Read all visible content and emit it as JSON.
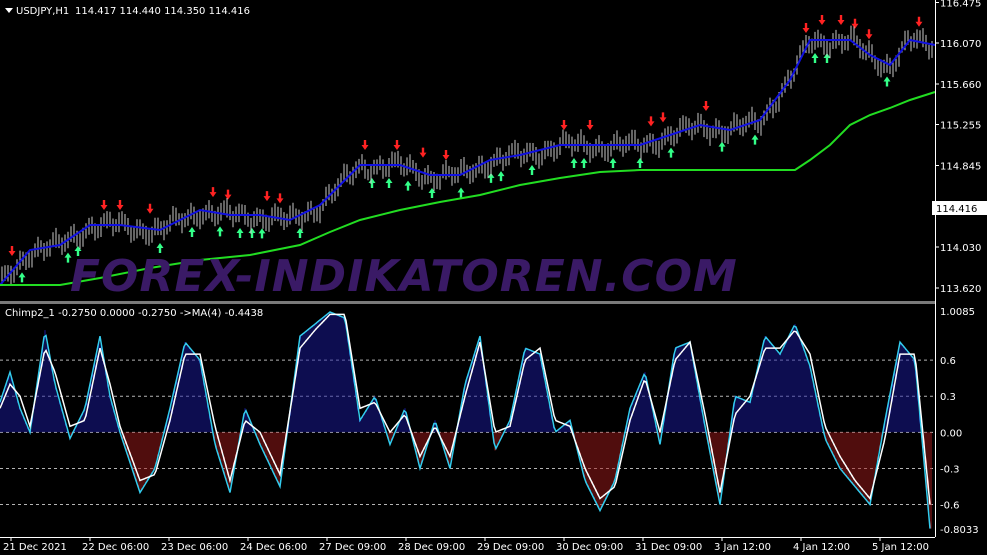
{
  "header": {
    "symbol": "USDJPY,H1",
    "ohlc": "114.417 114.440 114.350 114.416"
  },
  "indicator_header": "Chimp2_1 -0.2750 0.0000 -0.2750  ->MA(4) -0.4438",
  "watermark": "FOREX-INDIKATOREN.COM",
  "colors": {
    "background": "#000000",
    "upper_band": "#1010e0",
    "ma_green": "#22dd22",
    "arrow_up": "#33ff88",
    "arrow_down": "#ff2222",
    "hist_pos": "#1a1aa0",
    "hist_neg": "#a01a1a",
    "osc_cyan": "#33ccee",
    "osc_white": "#ffffff",
    "grid": "#b4b4b4"
  },
  "price_axis": {
    "labels": [
      "116.475",
      "116.070",
      "115.660",
      "115.255",
      "114.845",
      "114.416",
      "114.030",
      "113.620"
    ],
    "current_price": "114.416"
  },
  "indicator_axis": {
    "labels": [
      "1.0085",
      "0.6",
      "0.3",
      "0.00",
      "-0.3",
      "-0.6",
      "-0.8033"
    ]
  },
  "time_axis": {
    "labels": [
      "21 Dec 2021",
      "22 Dec 06:00",
      "23 Dec 06:00",
      "24 Dec 06:00",
      "27 Dec 09:00",
      "28 Dec 09:00",
      "29 Dec 09:00",
      "30 Dec 09:00",
      "31 Dec 09:00",
      "3 Jan 12:00",
      "4 Jan 12:00",
      "5 Jan 12:00"
    ]
  },
  "chart_data": [
    {
      "type": "line",
      "title": "USDJPY,H1",
      "ylim": [
        113.5,
        116.5
      ],
      "series": [
        {
          "name": "",
          "x": [
            0,
            30,
            60,
            90,
            120,
            160,
            200,
            230,
            260,
            290,
            320,
            340,
            360,
            380,
            400,
            430,
            460,
            490,
            520,
            560,
            600,
            640,
            670,
            700,
            730,
            760,
            790,
            810,
            830,
            850,
            870,
            890,
            910,
            935
          ],
          "values": [
            113.65,
            114.0,
            114.05,
            114.25,
            114.25,
            114.2,
            114.4,
            114.35,
            114.35,
            114.3,
            114.45,
            114.65,
            114.85,
            114.85,
            114.85,
            114.75,
            114.75,
            114.9,
            114.95,
            115.05,
            115.05,
            115.05,
            115.15,
            115.25,
            115.2,
            115.3,
            115.7,
            116.1,
            116.1,
            116.1,
            115.95,
            115.85,
            116.1,
            116.05
          ]
        },
        {
          "name": "",
          "x": [
            0,
            60,
            100,
            150,
            200,
            250,
            300,
            330,
            360,
            400,
            440,
            480,
            520,
            560,
            600,
            640,
            680,
            720,
            760,
            795,
            810,
            830,
            850,
            870,
            890,
            910,
            935
          ],
          "values": [
            113.65,
            113.65,
            113.72,
            113.82,
            113.9,
            113.95,
            114.05,
            114.18,
            114.3,
            114.4,
            114.48,
            114.55,
            114.65,
            114.72,
            114.78,
            114.8,
            114.8,
            114.8,
            114.8,
            114.8,
            114.9,
            115.05,
            115.25,
            115.35,
            115.42,
            115.5,
            115.58
          ]
        }
      ]
    },
    {
      "type": "line",
      "title": "Chimp2_1",
      "ylim": [
        -0.8033,
        1.0085
      ],
      "series": [
        {
          "name": "",
          "x": [
            0,
            10,
            20,
            30,
            45,
            55,
            70,
            85,
            100,
            110,
            120,
            140,
            155,
            170,
            185,
            200,
            215,
            230,
            245,
            260,
            280,
            300,
            315,
            330,
            345,
            360,
            375,
            390,
            405,
            420,
            435,
            450,
            465,
            480,
            495,
            510,
            525,
            540,
            555,
            570,
            585,
            600,
            615,
            630,
            645,
            660,
            675,
            690,
            705,
            720,
            735,
            750,
            765,
            780,
            795,
            810,
            825,
            840,
            855,
            870,
            885,
            900,
            915,
            930
          ],
          "values": [
            0.25,
            0.5,
            0.2,
            0.0,
            0.85,
            0.4,
            -0.05,
            0.2,
            0.8,
            0.3,
            0.0,
            -0.5,
            -0.3,
            0.2,
            0.75,
            0.6,
            -0.1,
            -0.5,
            0.2,
            -0.1,
            -0.45,
            0.8,
            0.9,
            1.0,
            0.95,
            0.1,
            0.3,
            -0.1,
            0.2,
            -0.3,
            0.1,
            -0.3,
            0.4,
            0.8,
            -0.15,
            0.1,
            0.7,
            0.65,
            0.0,
            0.1,
            -0.4,
            -0.65,
            -0.4,
            0.2,
            0.5,
            -0.1,
            0.7,
            0.75,
            0.05,
            -0.6,
            0.3,
            0.25,
            0.8,
            0.65,
            0.9,
            0.55,
            -0.05,
            -0.3,
            -0.45,
            -0.6,
            0.1,
            0.75,
            0.6,
            -0.8
          ]
        },
        {
          "name": "",
          "x": [
            0,
            10,
            20,
            30,
            45,
            55,
            70,
            85,
            100,
            110,
            120,
            140,
            155,
            170,
            185,
            200,
            215,
            230,
            245,
            260,
            280,
            300,
            315,
            330,
            345,
            360,
            375,
            390,
            405,
            420,
            435,
            450,
            465,
            480,
            495,
            510,
            525,
            540,
            555,
            570,
            585,
            600,
            615,
            630,
            645,
            660,
            675,
            690,
            705,
            720,
            735,
            750,
            765,
            780,
            795,
            810,
            825,
            840,
            855,
            870,
            885,
            900,
            915,
            930
          ],
          "values": [
            0.2,
            0.4,
            0.3,
            0.05,
            0.7,
            0.5,
            0.05,
            0.1,
            0.7,
            0.4,
            0.05,
            -0.4,
            -0.35,
            0.1,
            0.65,
            0.65,
            0.05,
            -0.4,
            0.1,
            0.0,
            -0.35,
            0.7,
            0.85,
            0.98,
            0.98,
            0.2,
            0.25,
            0.0,
            0.15,
            -0.2,
            0.05,
            -0.2,
            0.3,
            0.75,
            0.0,
            0.05,
            0.6,
            0.7,
            0.1,
            0.05,
            -0.3,
            -0.55,
            -0.45,
            0.1,
            0.45,
            0.0,
            0.6,
            0.75,
            0.15,
            -0.5,
            0.15,
            0.3,
            0.7,
            0.7,
            0.85,
            0.65,
            0.05,
            -0.2,
            -0.4,
            -0.55,
            -0.05,
            0.65,
            0.65,
            -0.6
          ]
        }
      ]
    }
  ]
}
